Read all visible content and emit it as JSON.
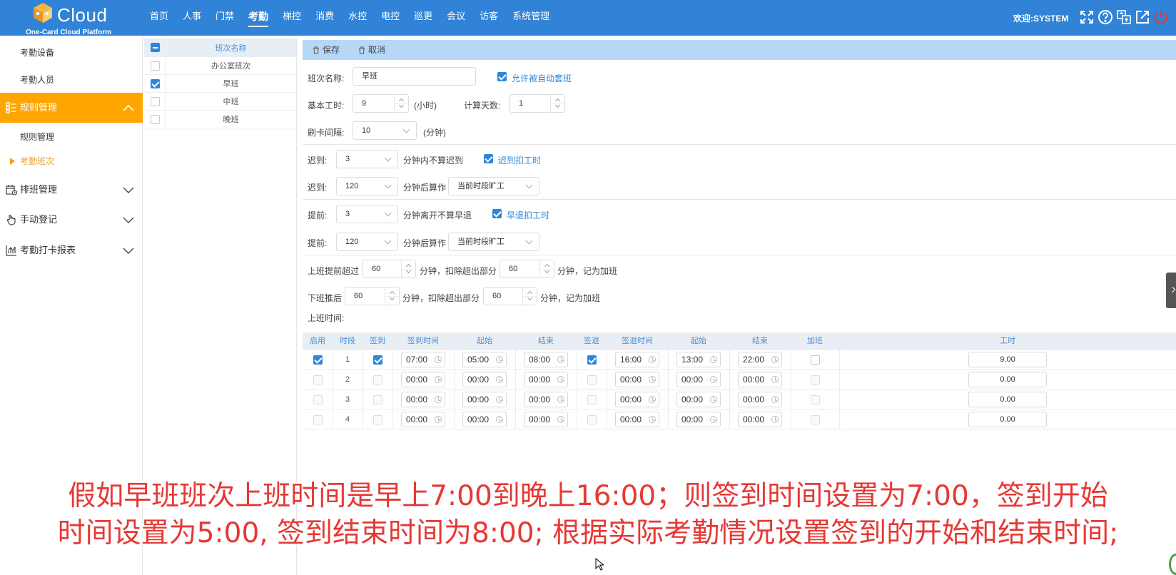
{
  "header": {
    "brand": "Cloud",
    "subtitle": "One-Card Cloud Platform",
    "nav": [
      "首页",
      "人事",
      "门禁",
      "考勤",
      "梯控",
      "消费",
      "水控",
      "电控",
      "巡更",
      "会议",
      "访客",
      "系统管理"
    ],
    "active_nav": "考勤",
    "welcome": "欢迎:SYSTEM",
    "accent": "#3083d6"
  },
  "sidebar": {
    "top_items": [
      "考勤设备",
      "考勤人员"
    ],
    "groups": [
      {
        "label": "规则管理",
        "icon": "list-icon",
        "expanded": true,
        "children": [
          "规则管理",
          "考勤班次"
        ]
      },
      {
        "label": "排班管理",
        "icon": "calendar-icon",
        "expanded": false
      },
      {
        "label": "手动登记",
        "icon": "hand-icon",
        "expanded": false
      },
      {
        "label": "考勤打卡报表",
        "icon": "chart-icon",
        "expanded": false
      }
    ],
    "active_color": "#ffa500"
  },
  "shift_list": {
    "header": "班次名称",
    "rows": [
      {
        "name": "办公室班次",
        "checked": false
      },
      {
        "name": "早班",
        "checked": true
      },
      {
        "name": "中班",
        "checked": false
      },
      {
        "name": "晚班",
        "checked": false
      }
    ]
  },
  "toolbar": {
    "save": "保存",
    "cancel": "取消"
  },
  "form": {
    "shift_name_label": "班次名称:",
    "shift_name_value": "早班",
    "auto_shift_label": "允许被自动套班",
    "base_hours_label": "基本工时:",
    "base_hours_value": "9",
    "base_hours_unit": "(小时)",
    "calc_days_label": "计算天数:",
    "calc_days_value": "1",
    "swipe_interval_label": "刷卡间隔:",
    "swipe_interval_value": "10",
    "swipe_interval_unit": "(分钟)",
    "late1_label": "迟到:",
    "late1_value": "3",
    "late1_text": "分钟内不算迟到",
    "late_deduct_label": "迟到扣工时",
    "late2_label": "迟到:",
    "late2_value": "120",
    "late2_text": "分钟后算作",
    "late2_select": "当前时段旷工",
    "early1_label": "提前:",
    "early1_value": "3",
    "early1_text": "分钟离开不算早退",
    "early_deduct_label": "早退扣工时",
    "early2_label": "提前:",
    "early2_value": "120",
    "early2_text": "分钟后算作",
    "early2_select": "当前时段旷工",
    "ot_before_label": "上班提前超过",
    "ot_before_value": "60",
    "ot_before_mid": "分钟，扣除超出部分",
    "ot_before_deduct": "60",
    "ot_before_tail": "分钟，记为加班",
    "ot_after_label": "下班推后",
    "ot_after_value": "60",
    "ot_after_mid": "分钟，扣除超出部分",
    "ot_after_deduct": "60",
    "ot_after_tail": "分钟，记为加班",
    "work_time_label": "上班时间:"
  },
  "time_table": {
    "headers": [
      "启用",
      "时段",
      "签到",
      "签到时间",
      "起始",
      "结束",
      "签退",
      "签退时间",
      "起始",
      "结束",
      "加班",
      "工时"
    ],
    "rows": [
      {
        "enabled": true,
        "period": "1",
        "sign_in": true,
        "in_time": "07:00",
        "in_start": "05:00",
        "in_end": "08:00",
        "sign_out": true,
        "out_time": "16:00",
        "out_start": "13:00",
        "out_end": "22:00",
        "overtime": false,
        "hours": "9.00"
      },
      {
        "enabled": false,
        "period": "2",
        "sign_in": false,
        "in_time": "00:00",
        "in_start": "00:00",
        "in_end": "00:00",
        "sign_out": false,
        "out_time": "00:00",
        "out_start": "00:00",
        "out_end": "00:00",
        "overtime": false,
        "hours": "0.00"
      },
      {
        "enabled": false,
        "period": "3",
        "sign_in": false,
        "in_time": "00:00",
        "in_start": "00:00",
        "in_end": "00:00",
        "sign_out": false,
        "out_time": "00:00",
        "out_start": "00:00",
        "out_end": "00:00",
        "overtime": false,
        "hours": "0.00"
      },
      {
        "enabled": false,
        "period": "4",
        "sign_in": false,
        "in_time": "00:00",
        "in_start": "00:00",
        "in_end": "00:00",
        "sign_out": false,
        "out_time": "00:00",
        "out_start": "00:00",
        "out_end": "00:00",
        "overtime": false,
        "hours": "0.00"
      }
    ]
  },
  "caption": {
    "line1": "假如早班班次上班时间是早上7:00到晚上16:00；则签到时间设置为7:00，签到开始",
    "line2": "时间设置为5:00, 签到结束时间为8:00; 根据实际考勤情况设置签到的开始和结束时间;"
  }
}
